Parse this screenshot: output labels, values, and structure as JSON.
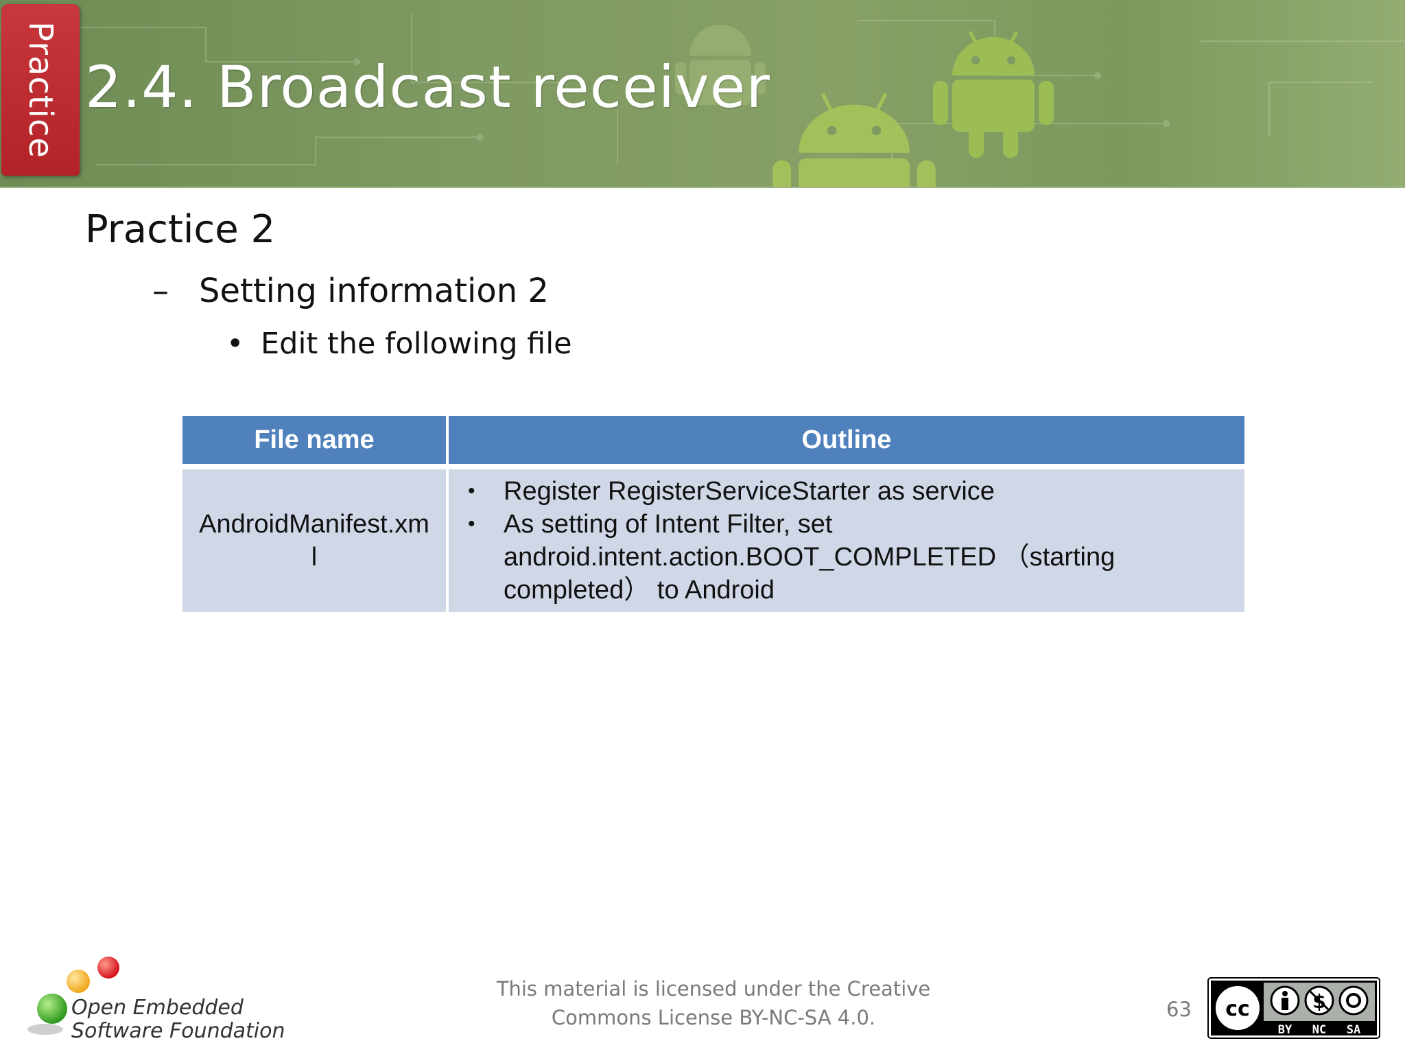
{
  "header": {
    "side_tab": "Practice",
    "title": "2.4. Broadcast receiver"
  },
  "content": {
    "level1": "Practice 2",
    "level2": "Setting information 2",
    "level3": "Edit the following file"
  },
  "table": {
    "headers": [
      "File name",
      "Outline"
    ],
    "rows": [
      {
        "file": "AndroidManifest.xml",
        "outline": [
          "Register RegisterServiceStarter as service",
          "As setting of Intent Filter, set android.intent.action.BOOT_COMPLETED （starting completed） to Android"
        ]
      }
    ]
  },
  "footer": {
    "logo_line1": "Open Embedded",
    "logo_line2": "Software Foundation",
    "license_line1": "This material is licensed under the Creative",
    "license_line2": "Commons License BY-NC-SA 4.0.",
    "page_number": "63",
    "cc_labels": [
      "BY",
      "NC",
      "SA"
    ]
  },
  "colors": {
    "banner_green": "#7f9a62",
    "tab_red": "#b22226",
    "table_header": "#4f81bd",
    "table_cell": "#d0d8e8"
  }
}
